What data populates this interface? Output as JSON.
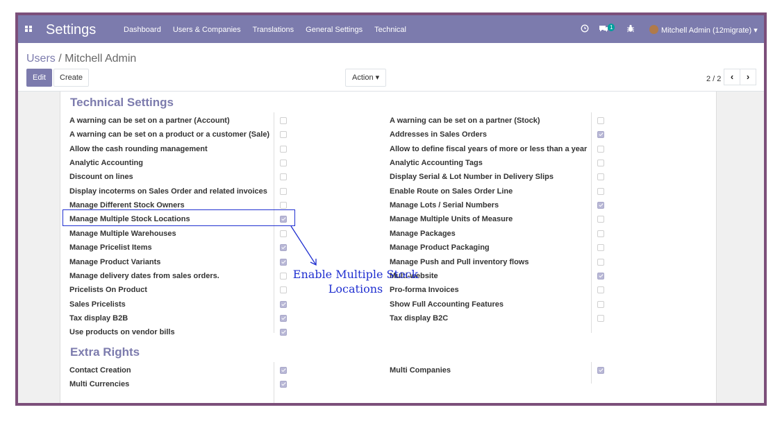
{
  "navbar": {
    "brand": "Settings",
    "menu": [
      "Dashboard",
      "Users & Companies",
      "Translations",
      "General Settings",
      "Technical"
    ],
    "activity_badge": "1",
    "user": "Mitchell Admin (12migrate)"
  },
  "breadcrumb": {
    "parent": "Users",
    "separator": "/",
    "current": "Mitchell Admin"
  },
  "buttons": {
    "edit": "Edit",
    "create": "Create",
    "action": "Action ▾"
  },
  "pager": {
    "value": "2 / 2",
    "prev": "‹",
    "next": "›"
  },
  "technical_settings": {
    "title": "Technical Settings",
    "left": [
      {
        "label": "A warning can be set on a partner (Account)",
        "checked": false
      },
      {
        "label": "A warning can be set on a product or a customer (Sale)",
        "checked": false
      },
      {
        "label": "Allow the cash rounding management",
        "checked": false
      },
      {
        "label": "Analytic Accounting",
        "checked": false
      },
      {
        "label": "Discount on lines",
        "checked": false
      },
      {
        "label": "Display incoterms on Sales Order and related invoices",
        "checked": false
      },
      {
        "label": "Manage Different Stock Owners",
        "checked": false
      },
      {
        "label": "Manage Multiple Stock Locations",
        "checked": true
      },
      {
        "label": "Manage Multiple Warehouses",
        "checked": false
      },
      {
        "label": "Manage Pricelist Items",
        "checked": true
      },
      {
        "label": "Manage Product Variants",
        "checked": true
      },
      {
        "label": "Manage delivery dates from sales orders.",
        "checked": false
      },
      {
        "label": "Pricelists On Product",
        "checked": false
      },
      {
        "label": "Sales Pricelists",
        "checked": true
      },
      {
        "label": "Tax display B2B",
        "checked": true
      },
      {
        "label": "Use products on vendor bills",
        "checked": true
      }
    ],
    "right": [
      {
        "label": "A warning can be set on a partner (Stock)",
        "checked": false
      },
      {
        "label": "Addresses in Sales Orders",
        "checked": true
      },
      {
        "label": "Allow to define fiscal years of more or less than a year",
        "checked": false
      },
      {
        "label": "Analytic Accounting Tags",
        "checked": false
      },
      {
        "label": "Display Serial & Lot Number in Delivery Slips",
        "checked": false
      },
      {
        "label": "Enable Route on Sales Order Line",
        "checked": false
      },
      {
        "label": "Manage Lots / Serial Numbers",
        "checked": true
      },
      {
        "label": "Manage Multiple Units of Measure",
        "checked": false
      },
      {
        "label": "Manage Packages",
        "checked": false
      },
      {
        "label": "Manage Product Packaging",
        "checked": false
      },
      {
        "label": "Manage Push and Pull inventory flows",
        "checked": false
      },
      {
        "label": "Multi-website",
        "checked": true
      },
      {
        "label": "Pro-forma Invoices",
        "checked": false
      },
      {
        "label": "Show Full Accounting Features",
        "checked": false
      },
      {
        "label": "Tax display B2C",
        "checked": false
      }
    ]
  },
  "extra_rights": {
    "title": "Extra Rights",
    "left": [
      {
        "label": "Contact Creation",
        "checked": true
      },
      {
        "label": "Multi Currencies",
        "checked": true
      }
    ],
    "right": [
      {
        "label": "Multi Companies",
        "checked": true
      }
    ]
  },
  "annotation": {
    "line1": "Enable Multiple Stock",
    "line2": "Locations",
    "color": "#1f2fd0"
  },
  "colors": {
    "brand": "#7c7bad",
    "frame": "#7c4f7a"
  }
}
